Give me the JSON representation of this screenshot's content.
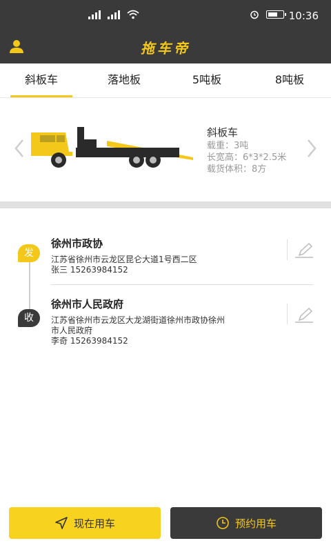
{
  "status_bar": {
    "time": "10:36",
    "network_1": "4G",
    "network_2": "4G",
    "battery_level_percent": 70
  },
  "app_bar": {
    "title": "拖车帝"
  },
  "tabs": [
    {
      "label": "斜板车",
      "active": true
    },
    {
      "label": "落地板",
      "active": false
    },
    {
      "label": "5吨板",
      "active": false
    },
    {
      "label": "8吨板",
      "active": false
    }
  ],
  "vehicle": {
    "name": "斜板车",
    "load": "载重：3吨",
    "dimensions": "长宽高：6*3*2.5米",
    "volume": "载货体积：8方"
  },
  "sender": {
    "badge": "发",
    "name": "徐州市政协",
    "address": "江苏省徐州市云龙区昆仑大道1号西二区",
    "contact": "张三  15263984152"
  },
  "receiver": {
    "badge": "收",
    "name": "徐州市人民政府",
    "address_line1": "江苏省徐州市云龙区大龙湖街道徐州市政协徐州",
    "address_line2": "市人民政府",
    "contact": "李奇  15263984152"
  },
  "actions": {
    "now_label": "现在用车",
    "book_label": "预约用车"
  },
  "colors": {
    "accent": "#f4c81a",
    "dark": "#3a3a3a"
  }
}
